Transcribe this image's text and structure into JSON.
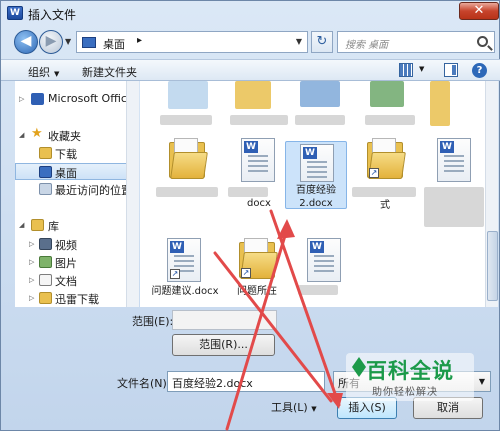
{
  "window": {
    "title": "插入文件",
    "close_icon": "✕"
  },
  "address": {
    "location": "桌面",
    "separator": "▸"
  },
  "search": {
    "placeholder": "搜索 桌面"
  },
  "toolbar": {
    "organize": "组织",
    "new_folder": "新建文件夹",
    "help_glyph": "?"
  },
  "sidebar": {
    "items": [
      {
        "label": "Microsoft Office",
        "icon": "word-icon"
      },
      {
        "label": "收藏夹",
        "icon": "star-icon"
      },
      {
        "label": "下载",
        "icon": "download-folder-icon"
      },
      {
        "label": "桌面",
        "icon": "desktop-icon",
        "selected": true
      },
      {
        "label": "最近访问的位置",
        "icon": "recent-places-icon"
      },
      {
        "label": "库",
        "icon": "library-icon"
      },
      {
        "label": "视频",
        "icon": "videos-icon"
      },
      {
        "label": "图片",
        "icon": "pictures-icon"
      },
      {
        "label": "文档",
        "icon": "documents-icon"
      },
      {
        "label": "迅雷下载",
        "icon": "download-folder-icon"
      }
    ]
  },
  "files": {
    "items": [
      {
        "label": "百度经验2.docx",
        "icon": "word-document-icon",
        "selected": true
      },
      {
        "label": "问题建议.docx",
        "icon": "word-document-icon"
      },
      {
        "label": "问题所在",
        "icon": "shortcut-folder-icon"
      },
      {
        "label": "式",
        "icon": "shortcut-folder-icon"
      },
      {
        "label": "docx",
        "icon": "word-document-icon"
      }
    ]
  },
  "bottom": {
    "range_label": "范围(E):",
    "range_button": "范围(R)...",
    "filename_label": "文件名(N):",
    "filename_value": "百度经验2.docx",
    "filetype_value": "所有",
    "tools_label": "工具(L)",
    "insert_button": "插入(S)",
    "cancel_button": "取消"
  },
  "watermark": {
    "title": "百科全说",
    "subtitle": "助你轻松解决"
  },
  "colors": {
    "accent": "#3c7fb1",
    "arrow": "#e24a4a",
    "selection": "#cce3fa",
    "watermark": "#1c9a4a"
  }
}
